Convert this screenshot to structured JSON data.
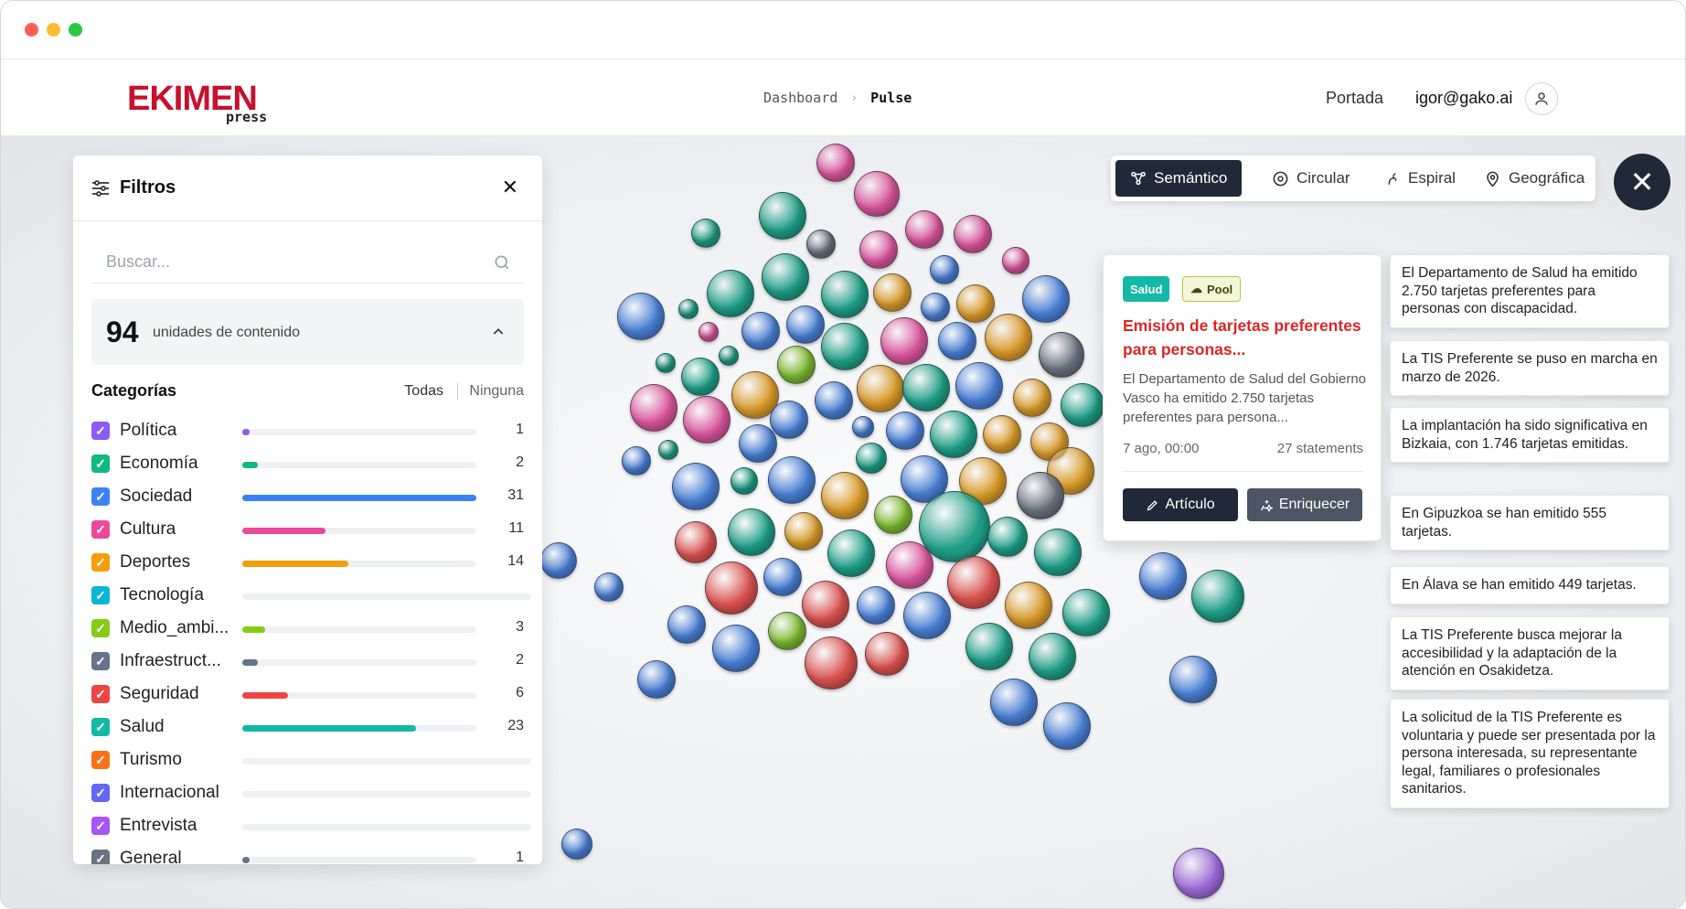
{
  "window": {
    "dots": [
      "#ff5f57",
      "#febc2e",
      "#28c840"
    ]
  },
  "header": {
    "logo": "EKIMEN",
    "logo_sub": "press",
    "breadcrumb": [
      "Dashboard",
      "Pulse"
    ],
    "portada": "Portada",
    "user_email": "igor@gako.ai",
    "user_icon": "user-icon"
  },
  "filters": {
    "title": "Filtros",
    "search_placeholder": "Buscar...",
    "count": "94",
    "count_label": "unidades de contenido",
    "categories_title": "Categorías",
    "all_label": "Todas",
    "none_label": "Ninguna",
    "categories": [
      {
        "name": "Política",
        "count": "1",
        "value": 1,
        "color": "#8b5cf6"
      },
      {
        "name": "Economía",
        "count": "2",
        "value": 2,
        "color": "#10b981"
      },
      {
        "name": "Sociedad",
        "count": "31",
        "value": 31,
        "color": "#3b82f6"
      },
      {
        "name": "Cultura",
        "count": "11",
        "value": 11,
        "color": "#ec4899"
      },
      {
        "name": "Deportes",
        "count": "14",
        "value": 14,
        "color": "#f59e0b"
      },
      {
        "name": "Tecnología",
        "count": "",
        "value": 0,
        "color": "#06b6d4"
      },
      {
        "name": "Medio_ambi...",
        "count": "3",
        "value": 3,
        "color": "#84cc16"
      },
      {
        "name": "Infraestruct...",
        "count": "2",
        "value": 2,
        "color": "#64748b"
      },
      {
        "name": "Seguridad",
        "count": "6",
        "value": 6,
        "color": "#ef4444"
      },
      {
        "name": "Salud",
        "count": "23",
        "value": 23,
        "color": "#14b8a6"
      },
      {
        "name": "Turismo",
        "count": "",
        "value": 0,
        "color": "#f97316"
      },
      {
        "name": "Internacional",
        "count": "",
        "value": 0,
        "color": "#6366f1"
      },
      {
        "name": "Entrevista",
        "count": "",
        "value": 0,
        "color": "#a855f7"
      },
      {
        "name": "General",
        "count": "1",
        "value": 1,
        "color": "#6b7280"
      }
    ]
  },
  "view_tabs": [
    {
      "label": "Semántico",
      "icon": "network-icon",
      "active": true
    },
    {
      "label": "Circular",
      "icon": "target-icon",
      "active": false
    },
    {
      "label": "Espiral",
      "icon": "spiral-icon",
      "active": false
    },
    {
      "label": "Geográfica",
      "icon": "map-pin-icon",
      "active": false
    }
  ],
  "card": {
    "tag_category": "Salud",
    "tag_source": "Pool",
    "title": "Emisión de tarjetas preferentes para personas...",
    "description": "El Departamento de Salud del Gobierno Vasco ha emitido 2.750 tarjetas preferentes para persona...",
    "date": "7 ago, 00:00",
    "statements": "27 statements",
    "article_button": "Artículo",
    "enrich_button": "Enriquecer"
  },
  "statements": [
    "El Departamento de Salud ha emitido 2.750 tarjetas preferentes para personas con discapacidad.",
    "La TIS Preferente se puso en marcha en marzo de 2026.",
    "La implantación ha sido significativa en Bizkaia, con 1.746 tarjetas emitidas.",
    "En Gipuzkoa se han emitido 555 tarjetas.",
    "En Álava se han emitido 449 tarjetas.",
    "La TIS Preferente busca mejorar la accesibilidad y la adaptación de la atención en Osakidetza.",
    "La solicitud de la TIS Preferente es voluntaria y puede ser presentada por la persona interesada, su representante legal, familiares o profesionales sanitarios."
  ],
  "palette": {
    "blue": "#4a7fd4",
    "teal": "#1f9e86",
    "pink": "#d9569b",
    "orange": "#d99a2b",
    "red": "#d9524f",
    "green": "#7cb82f",
    "gray": "#6b7280",
    "purple": "#9b6ad6"
  }
}
